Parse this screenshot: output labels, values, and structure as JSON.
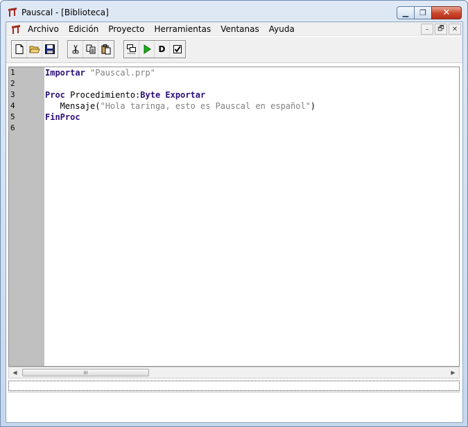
{
  "window": {
    "title": "Pauscal - [Biblioteca]",
    "caption_buttons": {
      "minimize": "▁",
      "maximize": "❐",
      "close": "✕"
    }
  },
  "menu": {
    "items": [
      "Archivo",
      "Edición",
      "Proyecto",
      "Herramientas",
      "Ventanas",
      "Ayuda"
    ],
    "mdi_buttons": {
      "minimize": "–",
      "restore": "🗗",
      "close": "✕"
    }
  },
  "toolbar": {
    "groups": [
      [
        "new-file-icon",
        "open-folder-icon",
        "save-icon"
      ],
      [
        "cut-icon",
        "copy-icon",
        "paste-icon"
      ],
      [
        "compile-icon",
        "run-icon",
        "debug-icon",
        "check-icon"
      ]
    ],
    "debug_label": "D"
  },
  "editor": {
    "line_numbers": [
      "1",
      "2",
      "3",
      "4",
      "5",
      "6"
    ],
    "lines": [
      [
        {
          "t": "Importar",
          "c": "kw"
        },
        {
          "t": " ",
          "c": ""
        },
        {
          "t": "\"Pauscal.prp\"",
          "c": "str"
        }
      ],
      [],
      [
        {
          "t": "Proc",
          "c": "kw"
        },
        {
          "t": " Procedimiento:",
          "c": ""
        },
        {
          "t": "Byte",
          "c": "kw"
        },
        {
          "t": " ",
          "c": ""
        },
        {
          "t": "Exportar",
          "c": "kw"
        }
      ],
      [
        {
          "t": "   Mensaje(",
          "c": ""
        },
        {
          "t": "\"Hola taringa, esto es Pauscal en español\"",
          "c": "str"
        },
        {
          "t": ")",
          "c": ""
        }
      ],
      [
        {
          "t": "FinProc",
          "c": "kw"
        }
      ],
      []
    ]
  },
  "scrollbar": {
    "left_arrow": "◀",
    "right_arrow": "▶",
    "grip": "III"
  },
  "colors": {
    "keyword": "#2b0f7a",
    "string": "#808080",
    "gutter": "#c0c0c0"
  }
}
